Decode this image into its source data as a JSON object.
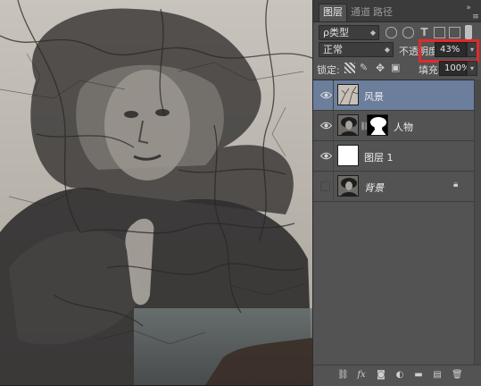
{
  "tabs": [
    {
      "label": "图层",
      "active": true
    },
    {
      "label": "通道",
      "active": false
    },
    {
      "label": "路径",
      "active": false
    }
  ],
  "filter": {
    "kind_label": "ρ类型"
  },
  "blend": {
    "mode": "正常",
    "opacity_label": "不透明度:",
    "opacity_value": "43%"
  },
  "lock": {
    "label": "锁定:",
    "fill_label": "填充:",
    "fill_value": "100%"
  },
  "layers": [
    {
      "name": "风景",
      "visible": true,
      "selected": true,
      "thumb": "scenery"
    },
    {
      "name": "人物",
      "visible": true,
      "selected": false,
      "thumb": "portrait",
      "has_mask": true
    },
    {
      "name": "图层 1",
      "visible": true,
      "selected": false,
      "thumb": "white"
    },
    {
      "name": "背景",
      "visible": false,
      "selected": false,
      "thumb": "portrait",
      "locked": true
    }
  ],
  "footer_icons": [
    "link-icon",
    "fx-icon",
    "mask-icon",
    "adjustment-icon",
    "group-icon",
    "new-layer-icon",
    "trash-icon"
  ],
  "colors": {
    "selection": "#6b7e9c",
    "highlight_box": "#e4292a",
    "panel_bg": "#535353"
  }
}
